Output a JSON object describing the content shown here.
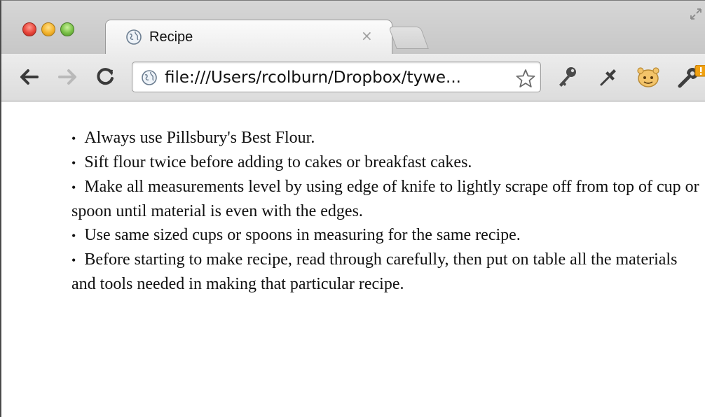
{
  "window": {
    "tab": {
      "title": "Recipe",
      "close_glyph": "×"
    },
    "toolbar": {
      "url": "file:///Users/rcolburn/Dropbox/tywe..."
    },
    "icons": {
      "tab_favicon": "globe-icon",
      "back": "arrow-left-icon",
      "forward": "arrow-right-icon",
      "reload": "reload-icon",
      "bookmark": "star-icon",
      "extensions": [
        "key-icon",
        "pin-icon",
        "face-icon",
        "wrench-icon"
      ],
      "restore": "fullscreen-icon"
    },
    "colors": {
      "chrome_bg": "#d6d6d6",
      "tab_bg": "#f3f3f3",
      "warning_badge": "#f0a010"
    }
  },
  "page": {
    "items": [
      {
        "bullet": "•",
        "text": "Always use Pillsbury's Best Flour."
      },
      {
        "bullet": "•",
        "text": "Sift flour twice before adding to cakes or breakfast cakes."
      },
      {
        "bullet": "•",
        "text": "Make all measurements level by using edge of knife to lightly scrape off from top of cup or spoon until material is even with the edges."
      },
      {
        "bullet": "•",
        "text": "Use same sized cups or spoons in measuring for the same recipe."
      },
      {
        "bullet": "•",
        "text": "Before starting to make recipe, read through carefully, then put on table all the materials and tools needed in making that particular recipe."
      }
    ]
  }
}
